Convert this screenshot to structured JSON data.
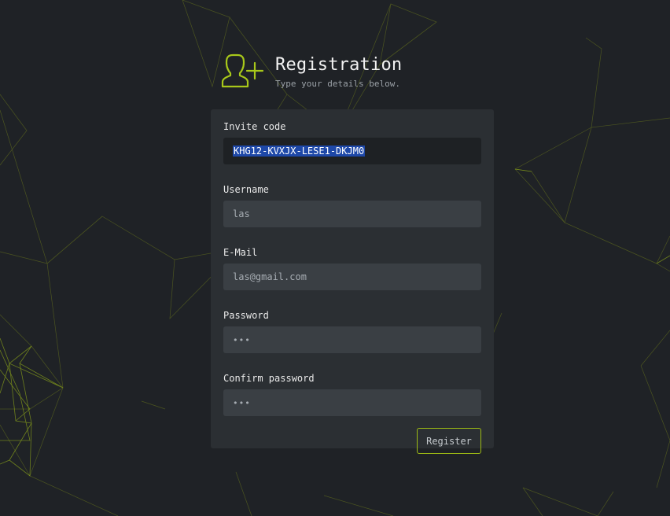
{
  "header": {
    "title": "Registration",
    "subtitle": "Type your details below.",
    "icon": "user-add-icon",
    "accent_color": "#a8c81a"
  },
  "form": {
    "invite_code": {
      "label": "Invite code",
      "value": "KHG12-KVXJX-LESE1-DKJM0",
      "selected": true
    },
    "username": {
      "label": "Username",
      "value": "las"
    },
    "email": {
      "label": "E-Mail",
      "value": "las@gmail.com"
    },
    "password": {
      "label": "Password",
      "value": "•••"
    },
    "confirm_password": {
      "label": "Confirm password",
      "value": "•••"
    },
    "submit_label": "Register"
  },
  "colors": {
    "background": "#1f2226",
    "card": "#2b2f33",
    "input": "#3a3f44",
    "selection": "#1e48a8",
    "button_border": "#9dbb14"
  }
}
